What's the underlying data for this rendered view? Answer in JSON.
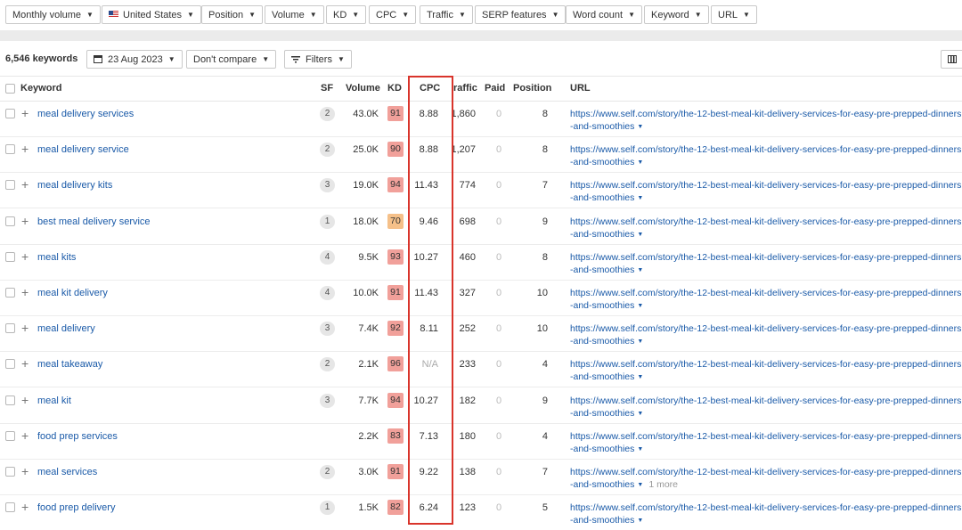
{
  "filters": [
    {
      "label": "Monthly volume"
    },
    {
      "label": "United States"
    },
    {
      "label": "Position"
    },
    {
      "label": "Volume"
    },
    {
      "label": "KD"
    },
    {
      "label": "CPC"
    },
    {
      "label": "Traffic"
    },
    {
      "label": "SERP features"
    },
    {
      "label": "Word count"
    },
    {
      "label": "Keyword"
    },
    {
      "label": "URL"
    }
  ],
  "toolbar": {
    "keyword_count": "6,546 keywords",
    "date": "23 Aug 2023",
    "compare": "Don't compare",
    "filters": "Filters"
  },
  "columns": {
    "keyword": "Keyword",
    "sf": "SF",
    "volume": "Volume",
    "kd": "KD",
    "cpc": "CPC",
    "traffic": "raffic",
    "paid": "Paid",
    "position": "Position",
    "url": "URL"
  },
  "kd_colors": {
    "red": "#f1a09a",
    "orange": "#f5c089"
  },
  "highlight_color": "#d9342b",
  "rows": [
    {
      "keyword": "meal delivery services",
      "sf": "2",
      "volume": "43.0K",
      "kd": "91",
      "kd_color": "#f1a09a",
      "cpc": "8.88",
      "traffic": "1,860",
      "paid": "0",
      "position": "8",
      "url": "https://www.self.com/story/the-12-best-meal-kit-delivery-services-for-easy-pre-prepped-dinners-and-smoothies",
      "more": ""
    },
    {
      "keyword": "meal delivery service",
      "sf": "2",
      "volume": "25.0K",
      "kd": "90",
      "kd_color": "#f1a09a",
      "cpc": "8.88",
      "traffic": "1,207",
      "paid": "0",
      "position": "8",
      "url": "https://www.self.com/story/the-12-best-meal-kit-delivery-services-for-easy-pre-prepped-dinners-and-smoothies",
      "more": ""
    },
    {
      "keyword": "meal delivery kits",
      "sf": "3",
      "volume": "19.0K",
      "kd": "94",
      "kd_color": "#f1a09a",
      "cpc": "11.43",
      "traffic": "774",
      "paid": "0",
      "position": "7",
      "url": "https://www.self.com/story/the-12-best-meal-kit-delivery-services-for-easy-pre-prepped-dinners-and-smoothies",
      "more": ""
    },
    {
      "keyword": "best meal delivery service",
      "sf": "1",
      "volume": "18.0K",
      "kd": "70",
      "kd_color": "#f5c089",
      "cpc": "9.46",
      "traffic": "698",
      "paid": "0",
      "position": "9",
      "url": "https://www.self.com/story/the-12-best-meal-kit-delivery-services-for-easy-pre-prepped-dinners-and-smoothies",
      "more": ""
    },
    {
      "keyword": "meal kits",
      "sf": "4",
      "volume": "9.5K",
      "kd": "93",
      "kd_color": "#f1a09a",
      "cpc": "10.27",
      "traffic": "460",
      "paid": "0",
      "position": "8",
      "url": "https://www.self.com/story/the-12-best-meal-kit-delivery-services-for-easy-pre-prepped-dinners-and-smoothies",
      "more": ""
    },
    {
      "keyword": "meal kit delivery",
      "sf": "4",
      "volume": "10.0K",
      "kd": "91",
      "kd_color": "#f1a09a",
      "cpc": "11.43",
      "traffic": "327",
      "paid": "0",
      "position": "10",
      "url": "https://www.self.com/story/the-12-best-meal-kit-delivery-services-for-easy-pre-prepped-dinners-and-smoothies",
      "more": ""
    },
    {
      "keyword": "meal delivery",
      "sf": "3",
      "volume": "7.4K",
      "kd": "92",
      "kd_color": "#f1a09a",
      "cpc": "8.11",
      "traffic": "252",
      "paid": "0",
      "position": "10",
      "url": "https://www.self.com/story/the-12-best-meal-kit-delivery-services-for-easy-pre-prepped-dinners-and-smoothies",
      "more": ""
    },
    {
      "keyword": "meal takeaway",
      "sf": "2",
      "volume": "2.1K",
      "kd": "96",
      "kd_color": "#f1a09a",
      "cpc": "N/A",
      "traffic": "233",
      "paid": "0",
      "position": "4",
      "url": "https://www.self.com/story/the-12-best-meal-kit-delivery-services-for-easy-pre-prepped-dinners-and-smoothies",
      "more": ""
    },
    {
      "keyword": "meal kit",
      "sf": "3",
      "volume": "7.7K",
      "kd": "94",
      "kd_color": "#f1a09a",
      "cpc": "10.27",
      "traffic": "182",
      "paid": "0",
      "position": "9",
      "url": "https://www.self.com/story/the-12-best-meal-kit-delivery-services-for-easy-pre-prepped-dinners-and-smoothies",
      "more": ""
    },
    {
      "keyword": "food prep services",
      "sf": "",
      "volume": "2.2K",
      "kd": "83",
      "kd_color": "#f1a09a",
      "cpc": "7.13",
      "traffic": "180",
      "paid": "0",
      "position": "4",
      "url": "https://www.self.com/story/the-12-best-meal-kit-delivery-services-for-easy-pre-prepped-dinners-and-smoothies",
      "more": ""
    },
    {
      "keyword": "meal services",
      "sf": "2",
      "volume": "3.0K",
      "kd": "91",
      "kd_color": "#f1a09a",
      "cpc": "9.22",
      "traffic": "138",
      "paid": "0",
      "position": "7",
      "url": "https://www.self.com/story/the-12-best-meal-kit-delivery-services-for-easy-pre-prepped-dinners-and-smoothies",
      "more": "1 more"
    },
    {
      "keyword": "food prep delivery",
      "sf": "1",
      "volume": "1.5K",
      "kd": "82",
      "kd_color": "#f1a09a",
      "cpc": "6.24",
      "traffic": "123",
      "paid": "0",
      "position": "5",
      "url": "https://www.self.com/story/the-12-best-meal-kit-delivery-services-for-easy-pre-prepped-dinners-and-smoothies",
      "more": ""
    }
  ]
}
